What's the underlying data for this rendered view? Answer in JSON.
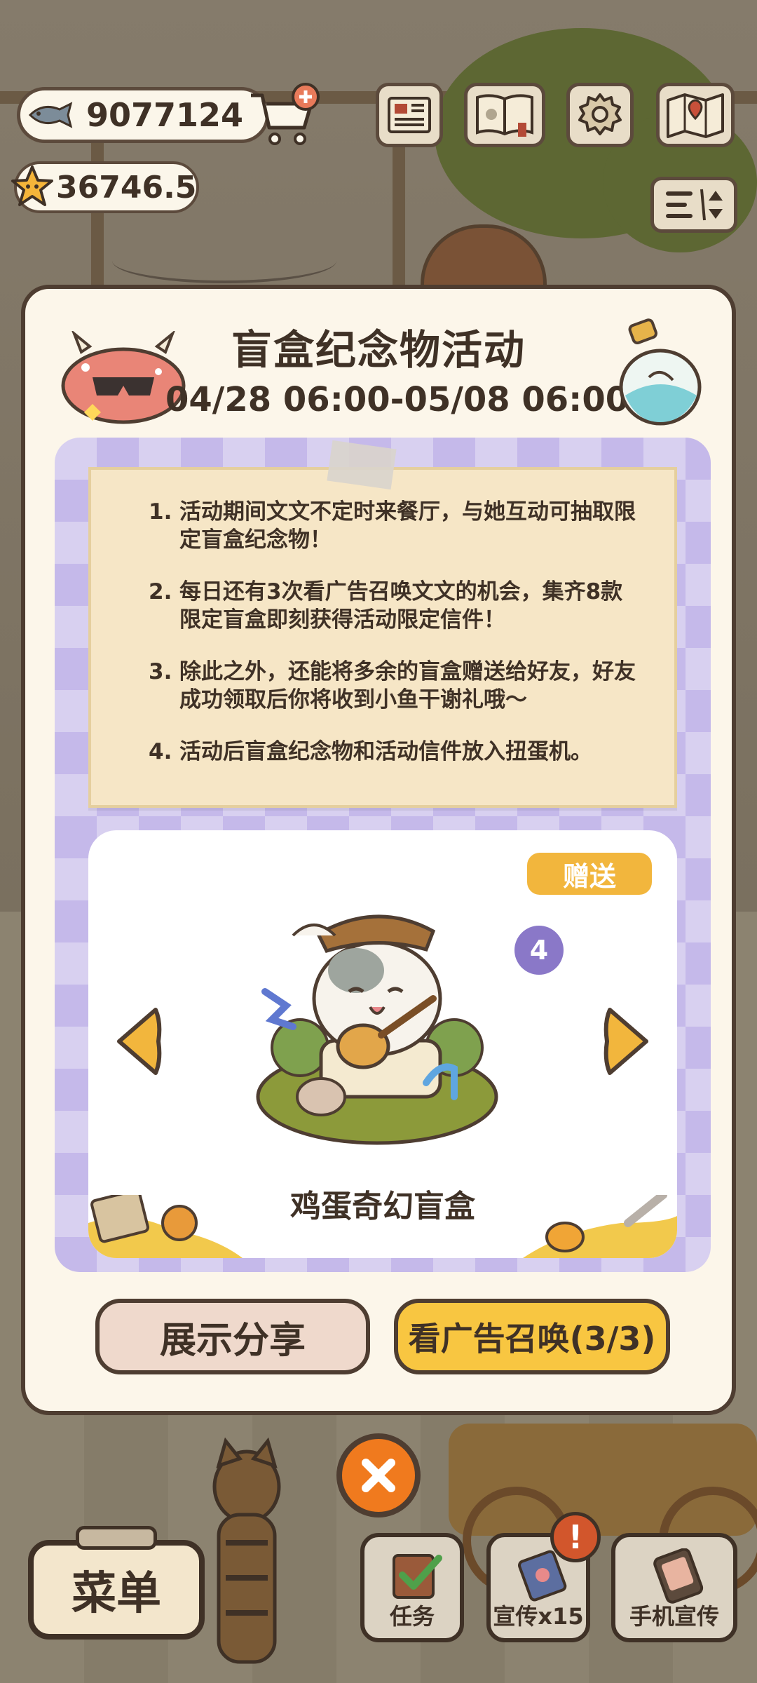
{
  "hud": {
    "fish_currency": "9077124",
    "star_currency": "36746.5"
  },
  "event": {
    "title": "盲盒纪念物活动",
    "date_range": "04/28 06:00-05/08 06:00",
    "rules": [
      {
        "num": "1.",
        "text": "活动期间文文不定时来餐厅，与她互动可抽取限定盲盒纪念物！"
      },
      {
        "num": "2.",
        "text": "每日还有3次看广告召唤文文的机会，集齐8款限定盲盒即刻获得活动限定信件！"
      },
      {
        "num": "3.",
        "text": "除此之外，还能将多余的盲盒赠送给好友，好友成功领取后你将收到小鱼干谢礼哦～"
      },
      {
        "num": "4.",
        "text": "活动后盲盒纪念物和活动信件放入扭蛋机。"
      }
    ],
    "gift_label": "赠送",
    "item_count": "4",
    "item_name": "鸡蛋奇幻盲盒",
    "share_label": "展示分享",
    "ad_label": "看广告召唤(3/3)"
  },
  "bottom": {
    "menu_label": "菜单",
    "task_label": "任务",
    "promo_label": "宣传x15",
    "phone_promo_label": "手机宣传",
    "alert": "!"
  },
  "icons": {
    "fish": "fish-icon",
    "star": "star-icon",
    "cart": "shopping-cart-plus-icon",
    "newspaper": "newspaper-icon",
    "book": "book-icon",
    "settings": "gear-icon",
    "map": "map-icon",
    "sort": "sort-icon",
    "close": "close-icon"
  },
  "colors": {
    "accent_yellow": "#f8c641",
    "gift_orange": "#f2b63d",
    "badge_purple": "#8a78c8",
    "close_orange": "#f07a1e",
    "outline": "#4e3d31"
  }
}
